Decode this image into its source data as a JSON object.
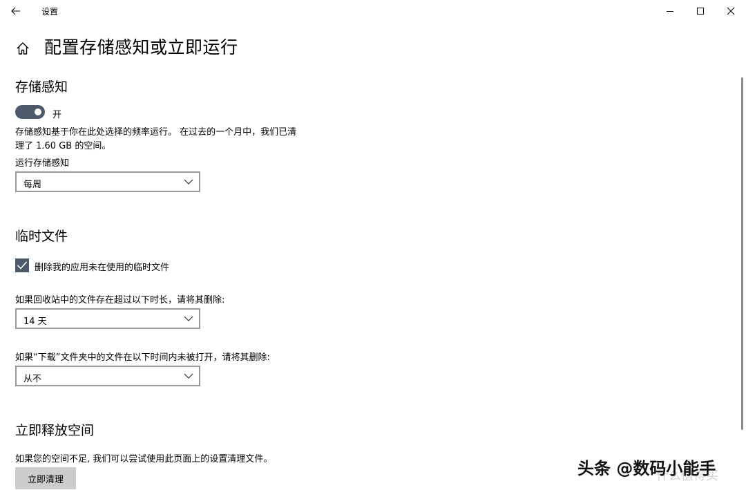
{
  "window": {
    "title": "设置",
    "back_icon": "back-arrow-icon",
    "minimize_icon": "minimize-icon",
    "maximize_icon": "maximize-icon",
    "close_icon": "close-icon"
  },
  "header": {
    "home_icon": "home-icon",
    "title": "配置存储感知或立即运行"
  },
  "storage_sense": {
    "title": "存储感知",
    "toggle_state": "开",
    "toggle_on": true,
    "description_line1": "存储感知基于你在此处选择的频率运行。 在过去的一个月中，我们已清",
    "description_line2": "理了 1.60 GB 的空间。",
    "run_label": "运行存储感知",
    "run_value": "每周"
  },
  "temp_files": {
    "title": "临时文件",
    "delete_apps_label": "删除我的应用未在使用的临时文件",
    "delete_apps_checked": true,
    "recycle_label": "如果回收站中的文件存在超过以下时长，请将其删除:",
    "recycle_value": "14 天",
    "downloads_label": "如果“下载”文件夹中的文件在以下时间内未被打开，请将其删除:",
    "downloads_value": "从不"
  },
  "free_space": {
    "title": "立即释放空间",
    "description": "如果您的空间不足, 我们可以尝试使用此页面上的设置清理文件。",
    "button_label": "立即清理"
  },
  "watermark": {
    "text": "头条 @数码小能手",
    "faded_text": "什么值得买"
  },
  "colors": {
    "accent": "#4c5a6b",
    "button_bg": "#cccccc",
    "dropdown_border": "#999999"
  }
}
